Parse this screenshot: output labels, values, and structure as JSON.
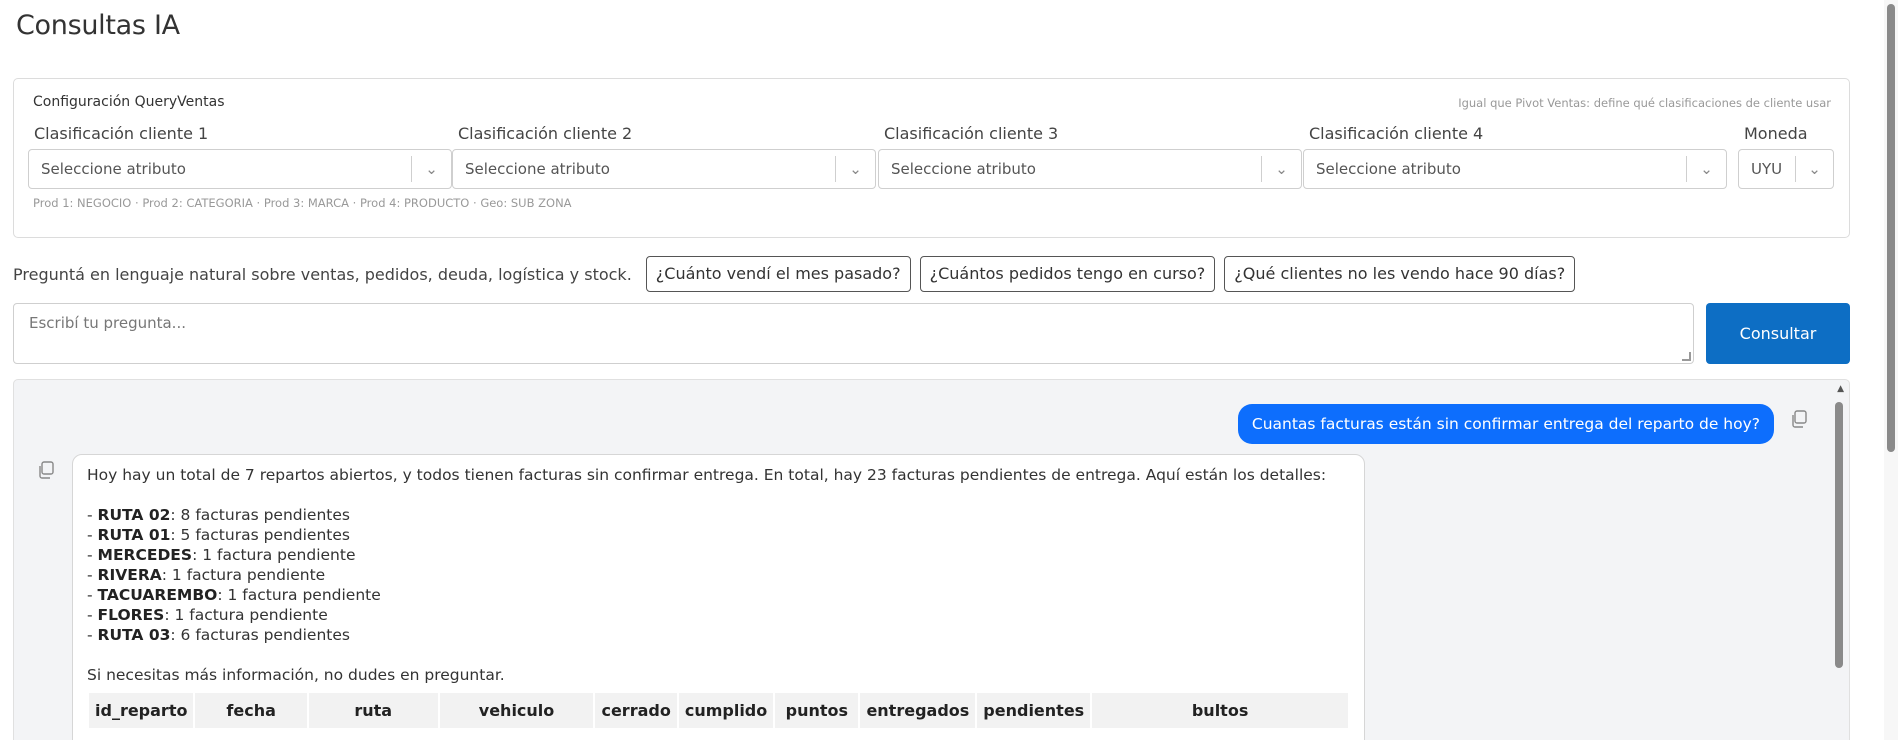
{
  "page": {
    "title": "Consultas IA"
  },
  "config": {
    "title": "Configuración QueryVentas",
    "hint": "Igual que Pivot Ventas: define qué clasificaciones de cliente usar",
    "fields": [
      {
        "label": "Clasificación cliente 1",
        "value": "Seleccione atributo"
      },
      {
        "label": "Clasificación cliente 2",
        "value": "Seleccione atributo"
      },
      {
        "label": "Clasificación cliente 3",
        "value": "Seleccione atributo"
      },
      {
        "label": "Clasificación cliente 4",
        "value": "Seleccione atributo"
      },
      {
        "label": "Moneda",
        "value": "UYU"
      }
    ],
    "footer": "Prod 1: NEGOCIO · Prod 2: CATEGORIA · Prod 3: MARCA · Prod 4: PRODUCTO · Geo: SUB ZONA"
  },
  "prompt": {
    "intro": "Preguntá en lenguaje natural sobre ventas, pedidos, deuda, logística y stock.",
    "suggestions": [
      "¿Cuánto vendí el mes pasado?",
      "¿Cuántos pedidos tengo en curso?",
      "¿Qué clientes no les vendo hace 90 días?"
    ],
    "placeholder": "Escribí tu pregunta...",
    "submit_label": "Consultar"
  },
  "chat": {
    "user_message": "Cuantas facturas están sin confirmar entrega del reparto de hoy?",
    "bot": {
      "intro": "Hoy hay un total de 7 repartos abiertos, y todos tienen facturas sin confirmar entrega. En total, hay 23 facturas pendientes de entrega. Aquí están los detalles:",
      "items": [
        {
          "route": "RUTA 02",
          "detail": ": 8 facturas pendientes"
        },
        {
          "route": "RUTA 01",
          "detail": ": 5 facturas pendientes"
        },
        {
          "route": "MERCEDES",
          "detail": ": 1 factura pendiente"
        },
        {
          "route": "RIVERA",
          "detail": ": 1 factura pendiente"
        },
        {
          "route": "TACUAREMBO",
          "detail": ": 1 factura pendiente"
        },
        {
          "route": "FLORES",
          "detail": ": 1 factura pendiente"
        },
        {
          "route": "RUTA 03",
          "detail": ": 6 facturas pendientes"
        }
      ],
      "outro": "Si necesitas más información, no dudes en preguntar.",
      "table_headers": [
        "id_reparto",
        "fecha",
        "ruta",
        "vehiculo",
        "cerrado",
        "cumplido",
        "puntos",
        "entregados",
        "pendientes",
        "bultos"
      ]
    }
  }
}
